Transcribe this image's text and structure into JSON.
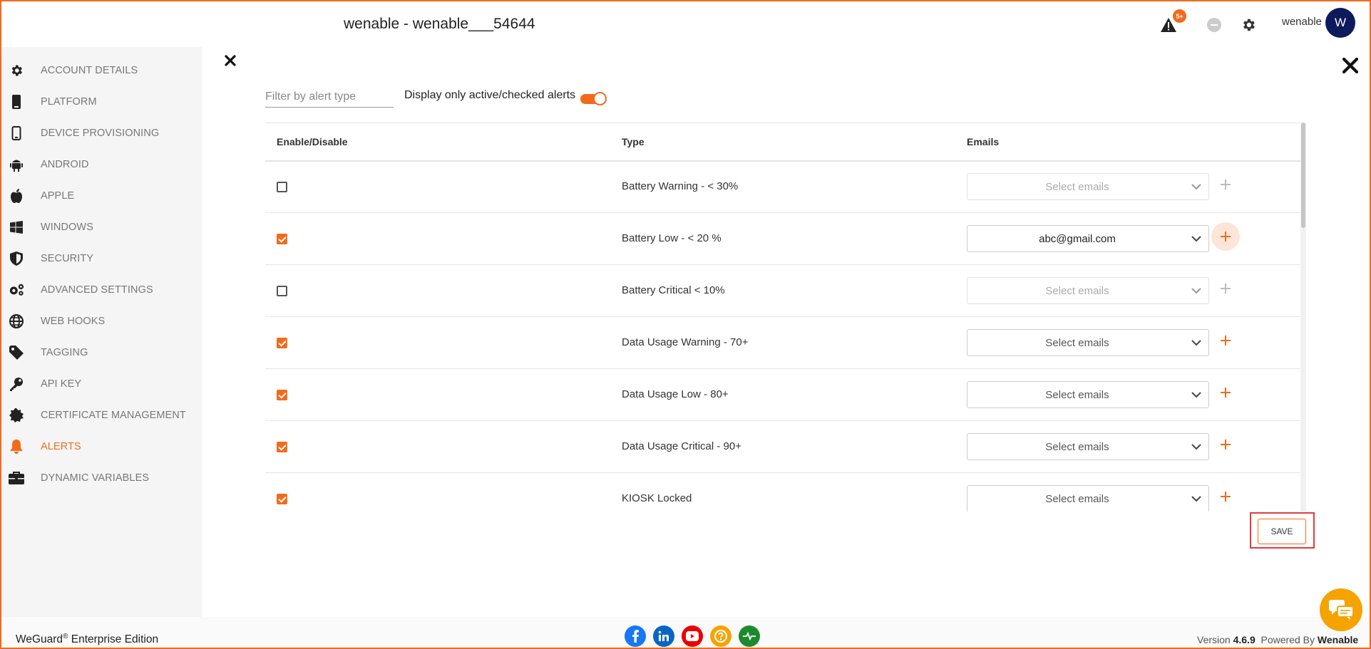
{
  "header": {
    "title": "wenable - wenable___54644",
    "alert_badge": "5+",
    "user_name": "wenable",
    "avatar_initial": "W"
  },
  "sidebar": {
    "items": [
      {
        "label": "ACCOUNT DETAILS",
        "icon": "gear-icon"
      },
      {
        "label": "PLATFORM",
        "icon": "phone-icon"
      },
      {
        "label": "DEVICE PROVISIONING",
        "icon": "mobile-outline-icon"
      },
      {
        "label": "ANDROID",
        "icon": "android-icon"
      },
      {
        "label": "APPLE",
        "icon": "apple-icon"
      },
      {
        "label": "WINDOWS",
        "icon": "windows-icon"
      },
      {
        "label": "SECURITY",
        "icon": "shield-icon"
      },
      {
        "label": "ADVANCED SETTINGS",
        "icon": "gears-icon"
      },
      {
        "label": "WEB HOOKS",
        "icon": "globe-icon"
      },
      {
        "label": "TAGGING",
        "icon": "tag-icon"
      },
      {
        "label": "API KEY",
        "icon": "key-icon"
      },
      {
        "label": "CERTIFICATE MANAGEMENT",
        "icon": "certificate-icon"
      },
      {
        "label": "ALERTS",
        "icon": "bell-icon",
        "active": true
      },
      {
        "label": "DYNAMIC VARIABLES",
        "icon": "briefcase-icon"
      }
    ]
  },
  "filter": {
    "placeholder": "Filter by alert type",
    "toggle_label": "Display only active/checked alerts",
    "toggle_on": true
  },
  "table": {
    "headers": {
      "enable": "Enable/Disable",
      "type": "Type",
      "emails": "Emails"
    },
    "rows": [
      {
        "checked": false,
        "type": "Battery Warning - < 30%",
        "email": "Select emails"
      },
      {
        "checked": true,
        "type": "Battery Low - < 20 %",
        "email": "abc@gmail.com"
      },
      {
        "checked": false,
        "type": "Battery Critical < 10%",
        "email": "Select emails"
      },
      {
        "checked": true,
        "type": "Data Usage Warning - 70+",
        "email": "Select emails"
      },
      {
        "checked": true,
        "type": "Data Usage Low - 80+",
        "email": "Select emails"
      },
      {
        "checked": true,
        "type": "Data Usage Critical - 90+",
        "email": "Select emails"
      },
      {
        "checked": true,
        "type": "KIOSK Locked",
        "email": "Select emails"
      }
    ]
  },
  "actions": {
    "save_label": "SAVE"
  },
  "footer": {
    "brand": "WeGuard",
    "brand_sup": "®",
    "brand_suffix": " Enterprise Edition",
    "version_prefix": "Version ",
    "version": "4.6.9",
    "powered_prefix": "  Powered By ",
    "powered_by": "Wenable"
  },
  "colors": {
    "accent": "#f26b1d",
    "avatar": "#0e1a5c",
    "chat": "#f5a300"
  }
}
